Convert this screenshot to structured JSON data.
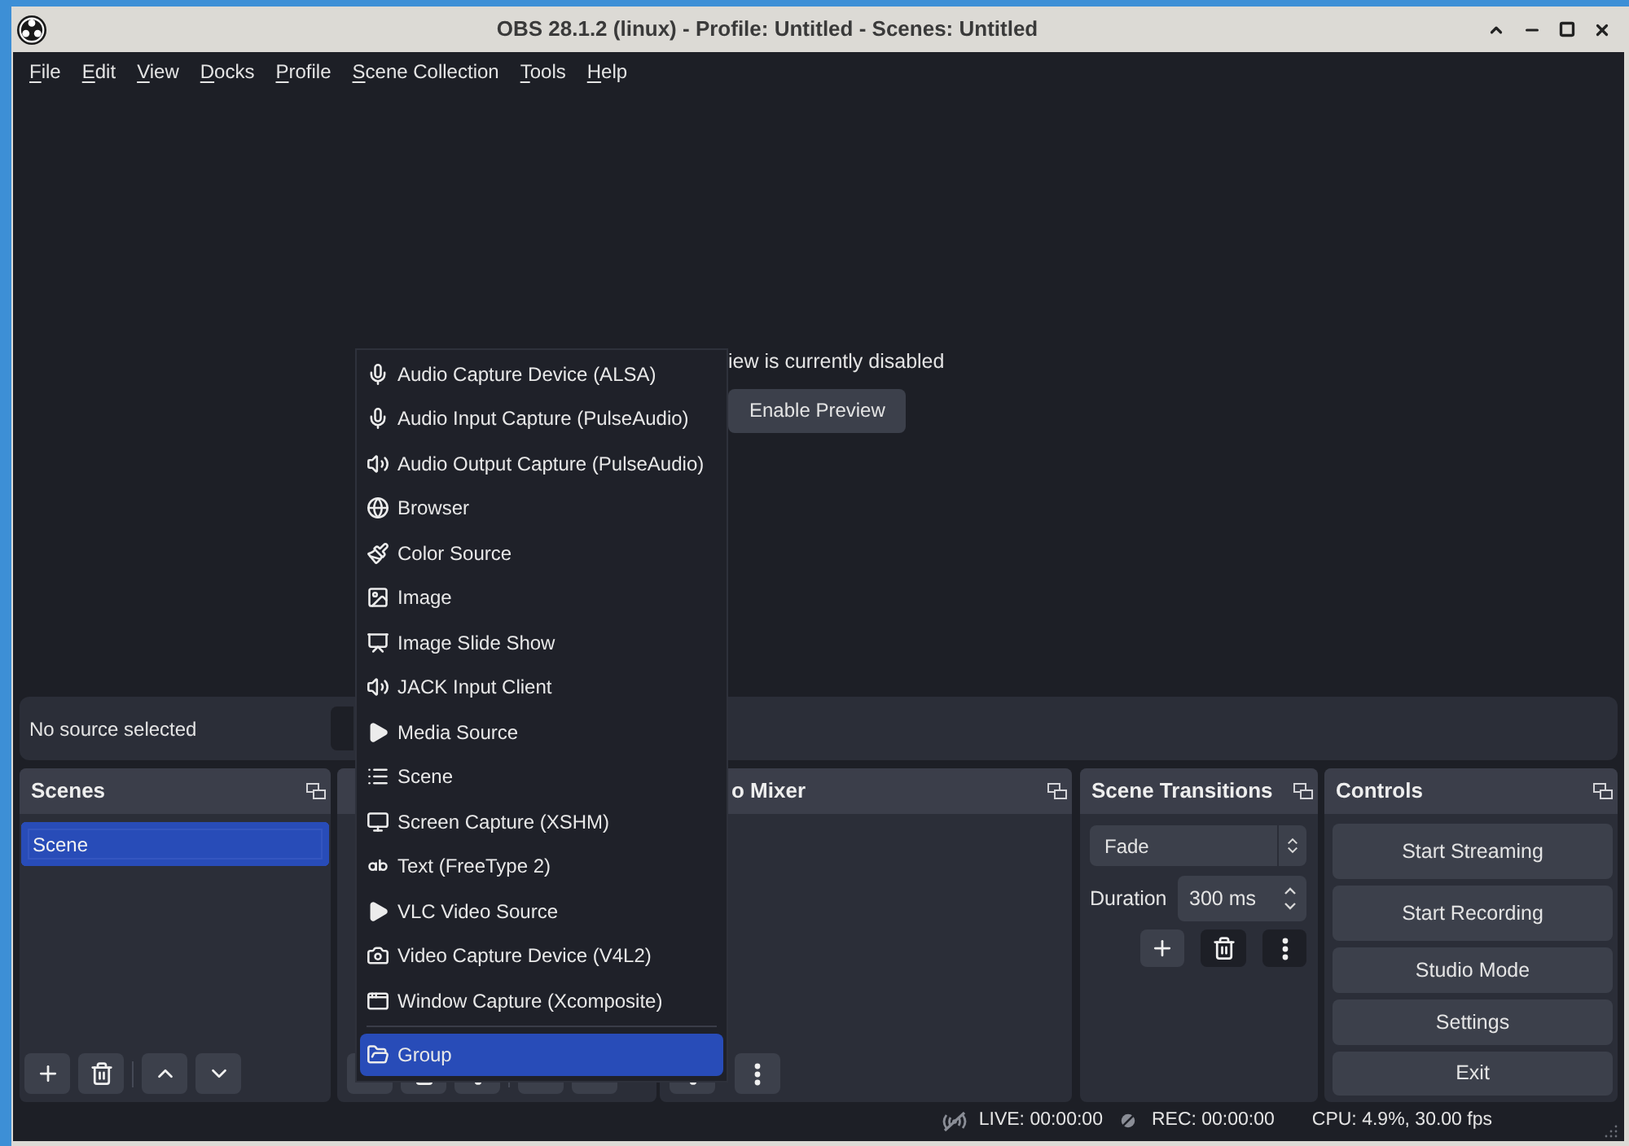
{
  "window": {
    "title": "OBS 28.1.2 (linux) - Profile: Untitled - Scenes: Untitled"
  },
  "menu_bar": [
    "File",
    "Edit",
    "View",
    "Docks",
    "Profile",
    "Scene Collection",
    "Tools",
    "Help"
  ],
  "preview": {
    "message": "iew is currently disabled",
    "button": "Enable Preview"
  },
  "context_bar": {
    "text": "No source selected"
  },
  "docks": {
    "scenes": {
      "title": "Scenes",
      "items": [
        {
          "label": "Scene",
          "selected": true
        }
      ]
    },
    "audio_mixer": {
      "title": "o Mixer"
    },
    "scene_transitions": {
      "title": "Scene Transitions",
      "transition": "Fade",
      "duration_label": "Duration",
      "duration": "300 ms"
    },
    "controls": {
      "title": "Controls",
      "buttons": [
        "Start Streaming",
        "Start Recording",
        "Studio Mode",
        "Settings",
        "Exit"
      ]
    }
  },
  "status_bar": {
    "live": "LIVE: 00:00:00",
    "rec": "REC: 00:00:00",
    "cpu": "CPU: 4.9%, 30.00 fps"
  },
  "context_menu": {
    "sections": [
      {
        "items": [
          {
            "label": "Audio Capture Device (ALSA)",
            "selected": false
          },
          {
            "label": "Audio Input Capture (PulseAudio)",
            "selected": false
          },
          {
            "label": "Audio Output Capture (PulseAudio)",
            "selected": false
          },
          {
            "label": "Browser",
            "selected": false
          },
          {
            "label": "Color Source",
            "selected": false
          },
          {
            "label": "Image",
            "selected": false
          },
          {
            "label": "Image Slide Show",
            "selected": false
          },
          {
            "label": "JACK Input Client",
            "selected": false
          },
          {
            "label": "Media Source",
            "selected": false
          },
          {
            "label": "Scene",
            "selected": false
          },
          {
            "label": "Screen Capture (XSHM)",
            "selected": false
          },
          {
            "label": "Text (FreeType 2)",
            "selected": false
          },
          {
            "label": "VLC Video Source",
            "selected": false
          },
          {
            "label": "Video Capture Device (V4L2)",
            "selected": false
          },
          {
            "label": "Window Capture (Xcomposite)",
            "selected": false
          }
        ]
      },
      {
        "items": [
          {
            "label": "Group",
            "selected": true
          }
        ]
      }
    ]
  }
}
